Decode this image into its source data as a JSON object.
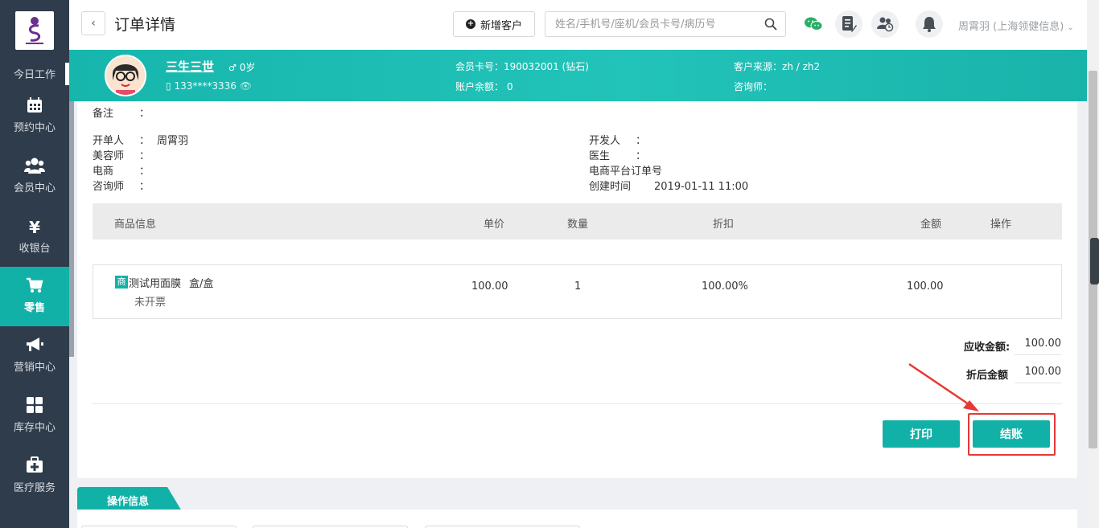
{
  "sidebar": {
    "today": "今日工作",
    "items": [
      {
        "label": "预约中心",
        "icon": "calendar-icon"
      },
      {
        "label": "会员中心",
        "icon": "members-icon"
      },
      {
        "label": "收银台",
        "icon": "yen-icon"
      },
      {
        "label": "零售",
        "icon": "cart-icon"
      },
      {
        "label": "营销中心",
        "icon": "megaphone-icon"
      },
      {
        "label": "库存中心",
        "icon": "grid-icon"
      },
      {
        "label": "医疗服务",
        "icon": "medkit-icon"
      }
    ],
    "active_index": 3
  },
  "header": {
    "title": "订单详情",
    "new_customer": "新增客户",
    "search_placeholder": "姓名/手机号/座机/会员卡号/病历号",
    "user": "周霄羽 (上海领健信息)"
  },
  "customer": {
    "name": "三生三世",
    "age": "0岁",
    "phone": "133****3336",
    "card_label": "会员卡号：",
    "card_value": "190032001 (钻石)",
    "balance_label": "账户余额：",
    "balance_value": "0",
    "source_label": "客户来源：",
    "source_value": "zh / zh2",
    "consultant_label": "咨询师："
  },
  "order": {
    "remark_label": "备注",
    "left_fields": [
      {
        "label": "开单人",
        "value": "周霄羽"
      },
      {
        "label": "美容师",
        "value": ""
      },
      {
        "label": "电商",
        "value": ""
      },
      {
        "label": "咨询师",
        "value": ""
      }
    ],
    "right_fields": [
      {
        "label": "开发人",
        "colon": "：",
        "value": ""
      },
      {
        "label": "医生",
        "colon": "：",
        "value": ""
      },
      {
        "label": "电商平台订单号",
        "colon": "",
        "value": ""
      },
      {
        "label": "创建时间",
        "colon": "",
        "value": "2019-01-11 11:00"
      }
    ],
    "colon": "："
  },
  "table": {
    "columns": [
      "商品信息",
      "单价",
      "数量",
      "折扣",
      "金额",
      "操作"
    ],
    "rows": [
      {
        "tag": "商",
        "name": "测试用面膜",
        "unit": "盒/盒",
        "invoice": "未开票",
        "price": "100.00",
        "qty": "1",
        "discount": "100.00%",
        "amount": "100.00"
      }
    ]
  },
  "summary": {
    "receivable_label": "应收金额:",
    "receivable_value": "100.00",
    "after_discount_label": "折后金额",
    "after_discount_value": "100.00"
  },
  "actions": {
    "print": "打印",
    "checkout": "结账"
  },
  "ops": {
    "tab": "操作信息"
  },
  "colors": {
    "accent": "#12b1a8",
    "sidebar": "#2f3c4b",
    "highlight": "#e53935"
  }
}
